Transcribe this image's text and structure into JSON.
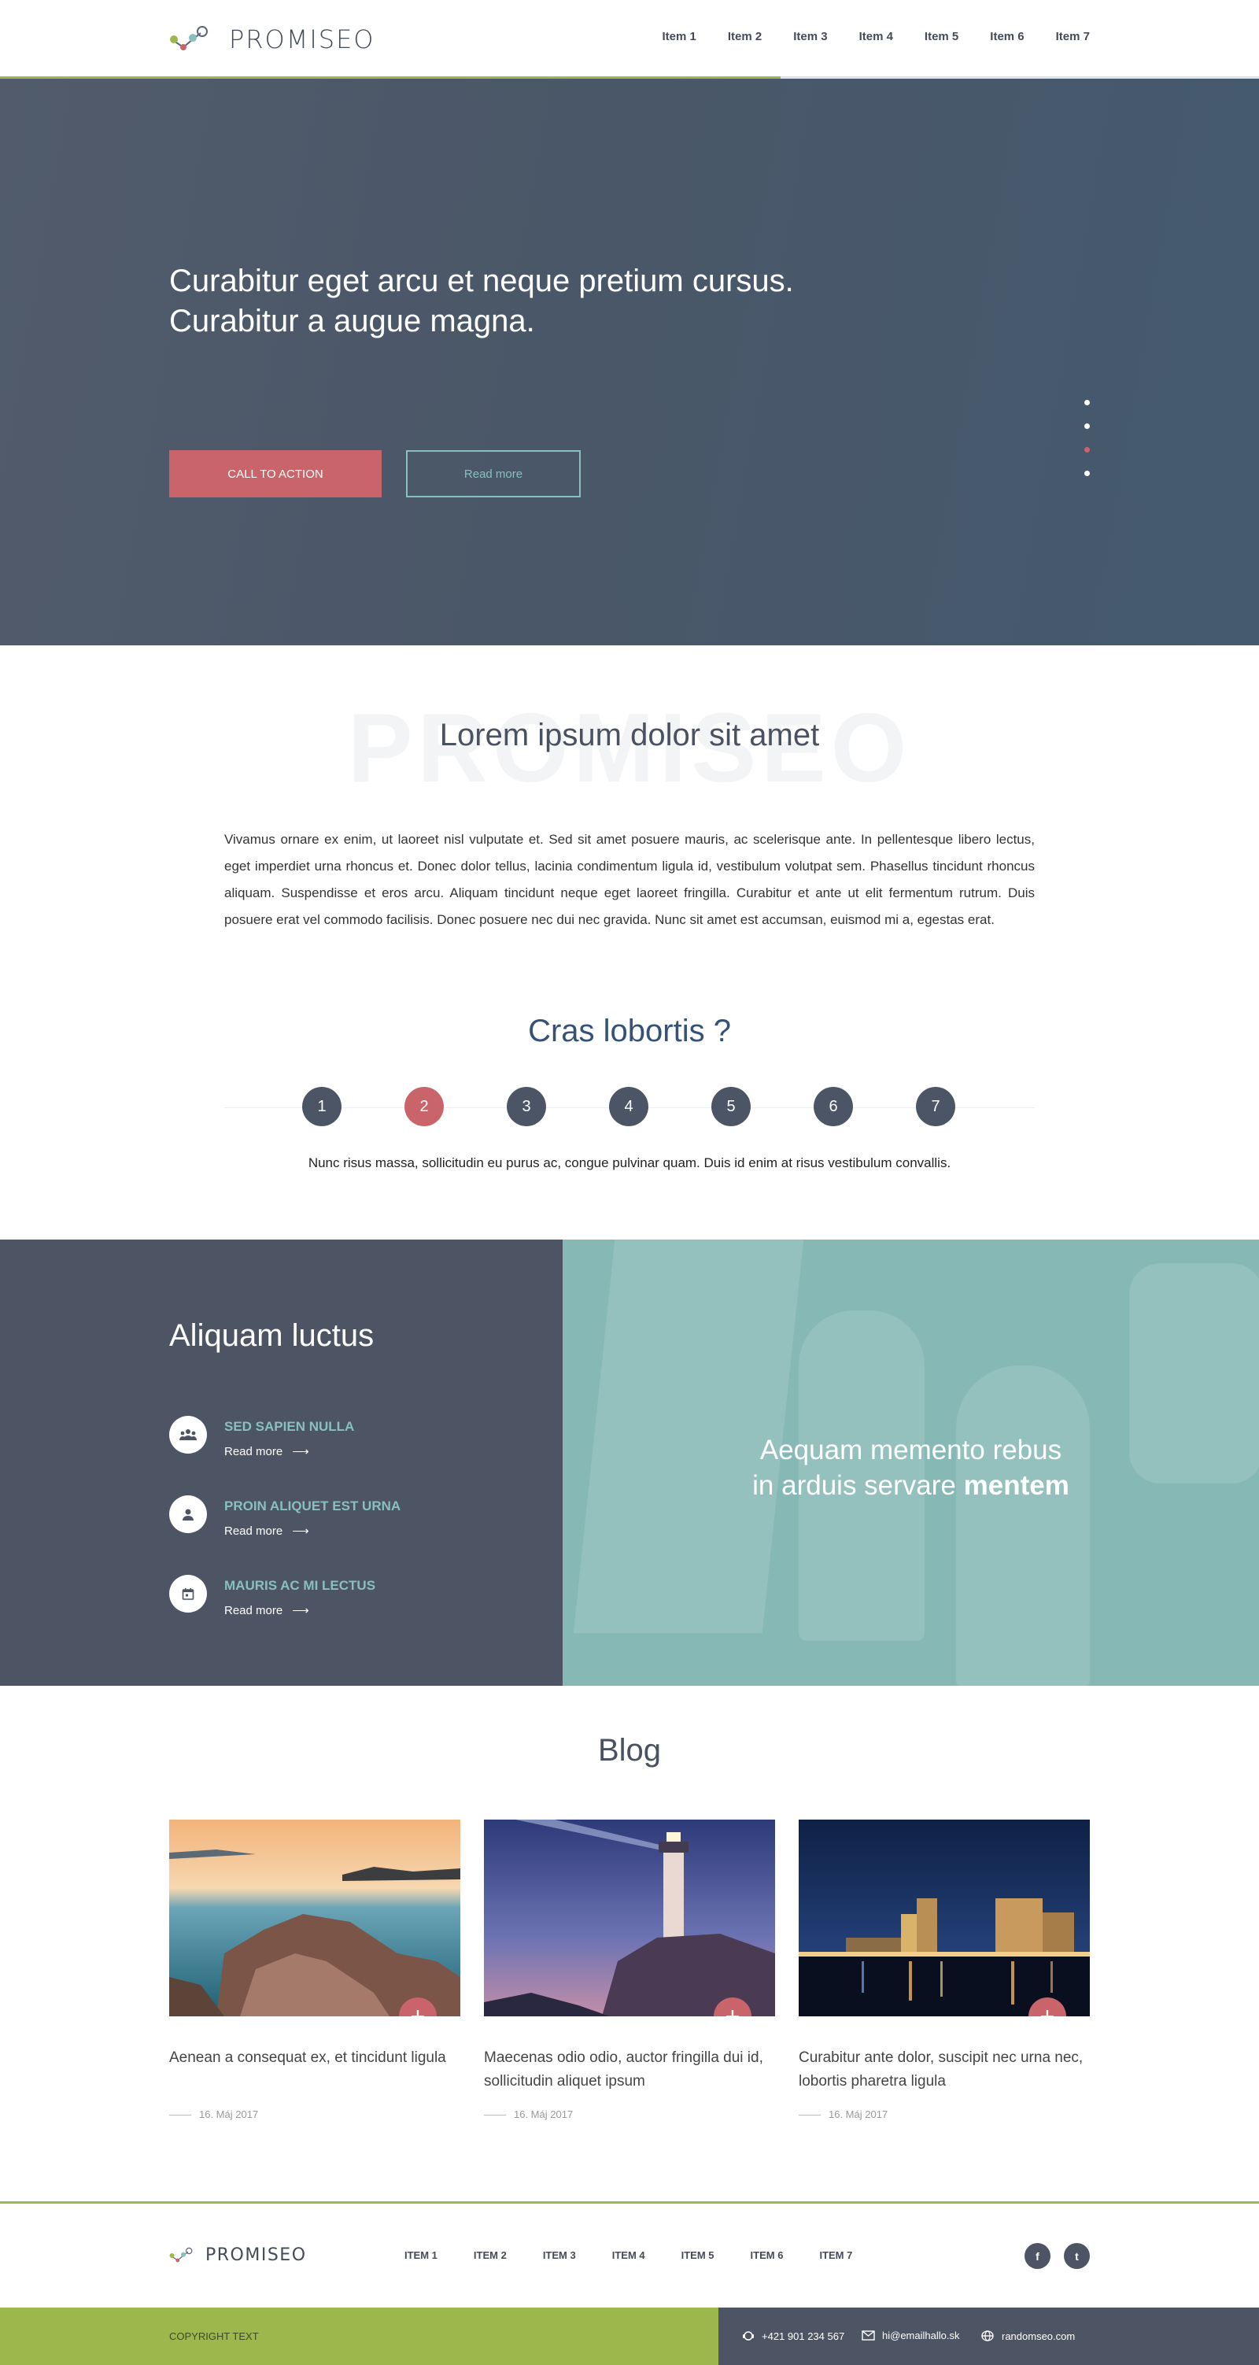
{
  "header": {
    "logo_text": "PROMISEO",
    "nav": [
      "Item 1",
      "Item 2",
      "Item 3",
      "Item 4",
      "Item 5",
      "Item 6",
      "Item 7"
    ]
  },
  "hero": {
    "title": "Curabitur eget arcu et neque pretium cursus. Curabitur a augue magna.",
    "cta_label": "CALL TO ACTION",
    "read_more_label": "Read more",
    "active_slide": 3,
    "slide_count": 4
  },
  "intro": {
    "watermark": "PROMISEO",
    "title": "Lorem ipsum dolor sit amet",
    "text": "Vivamus ornare ex enim, ut laoreet nisl vulputate et. Sed sit amet posuere mauris, ac scelerisque ante. In pellentesque libero lectus, eget imperdiet urna rhoncus et. Donec dolor tellus, lacinia condimentum ligula id, vestibulum volutpat sem. Phasellus tincidunt rhoncus aliquam. Suspendisse et eros arcu. Aliquam tincidunt neque eget laoreet fringilla. Curabitur et ante ut elit fermentum rutrum. Duis posuere erat vel commodo facilisis. Donec posuere nec dui nec gravida. Nunc sit amet est accumsan, euismod mi a, egestas erat."
  },
  "faq": {
    "title": "Cras lobortis ?",
    "steps": [
      "1",
      "2",
      "3",
      "4",
      "5",
      "6",
      "7"
    ],
    "active_step": "2",
    "text": "Nunc risus massa, sollicitudin eu purus ac, congue pulvinar quam. Duis id enim at risus vestibulum convallis."
  },
  "features": {
    "title": "Aliquam luctus",
    "items": [
      {
        "name": "SED SAPIEN NULLA",
        "link": "Read more",
        "icon": "group-icon"
      },
      {
        "name": "PROIN ALIQUET EST URNA",
        "link": "Read more",
        "icon": "person-icon"
      },
      {
        "name": "MAURIS AC MI LECTUS",
        "link": "Read more",
        "icon": "calendar-icon"
      }
    ],
    "quote_line1": "Aequam memento rebus",
    "quote_line2": "in arduis servare",
    "quote_bold": "mentem"
  },
  "blog": {
    "title": "Blog",
    "cards": [
      {
        "title": "Aenean a consequat ex, et tincidunt ligula",
        "date": "16. Máj 2017"
      },
      {
        "title": "Maecenas odio odio, auctor fringilla dui id, sollicitudin aliquet ipsum",
        "date": "16. Máj 2017"
      },
      {
        "title": " Curabitur ante dolor, suscipit nec urna nec, lobortis pharetra ligula",
        "date": "16. Máj 2017"
      }
    ]
  },
  "footer": {
    "logo_text": "PROMISEO",
    "nav": [
      "ITEM 1",
      "ITEM 2",
      "ITEM 3",
      "ITEM 4",
      "ITEM 5",
      "ITEM 6",
      "ITEM 7"
    ],
    "social": [
      {
        "label": "f",
        "icon": "facebook-icon"
      },
      {
        "label": "t",
        "icon": "twitter-icon"
      }
    ],
    "copyright": "COPYRIGHT TEXT",
    "phone": "+421 901 234 567",
    "email": "hi@emailhallo.sk",
    "website": "randomseo.com"
  },
  "colors": {
    "accent_green": "#9cb84c",
    "accent_red": "#c9656a",
    "teal": "#88c0bd",
    "dark": "#4d5464"
  }
}
